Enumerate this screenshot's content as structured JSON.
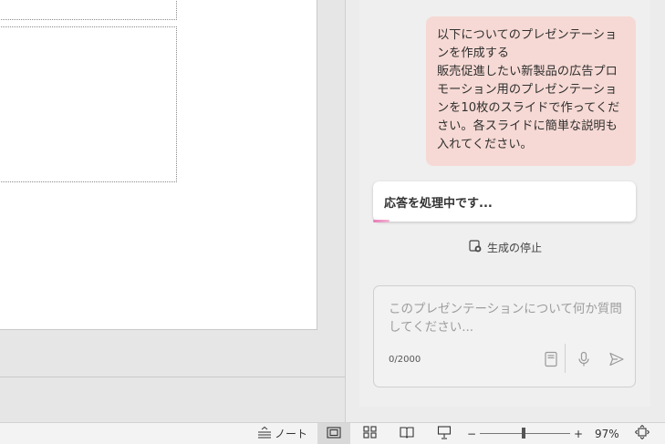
{
  "chat": {
    "user_message": "以下についてのプレゼンテーションを作成する\n販売促進したい新製品の広告プロモーション用のプレゼンテーションを10枚のスライドで作ってください。各スライドに簡単な説明も入れてください。",
    "status": "応答を処理中です...",
    "stop_label": "生成の停止"
  },
  "composer": {
    "placeholder": "このプレゼンテーションについて何か質問してください...",
    "value": "",
    "char_count": "0/2000"
  },
  "statusbar": {
    "notes_label": "ノート",
    "zoom_minus": "−",
    "zoom_plus": "+",
    "zoom_percent": "97%",
    "zoom_level": 97
  },
  "colors": {
    "user_bubble": "#f6d9d4",
    "accent": "#e879b8"
  }
}
